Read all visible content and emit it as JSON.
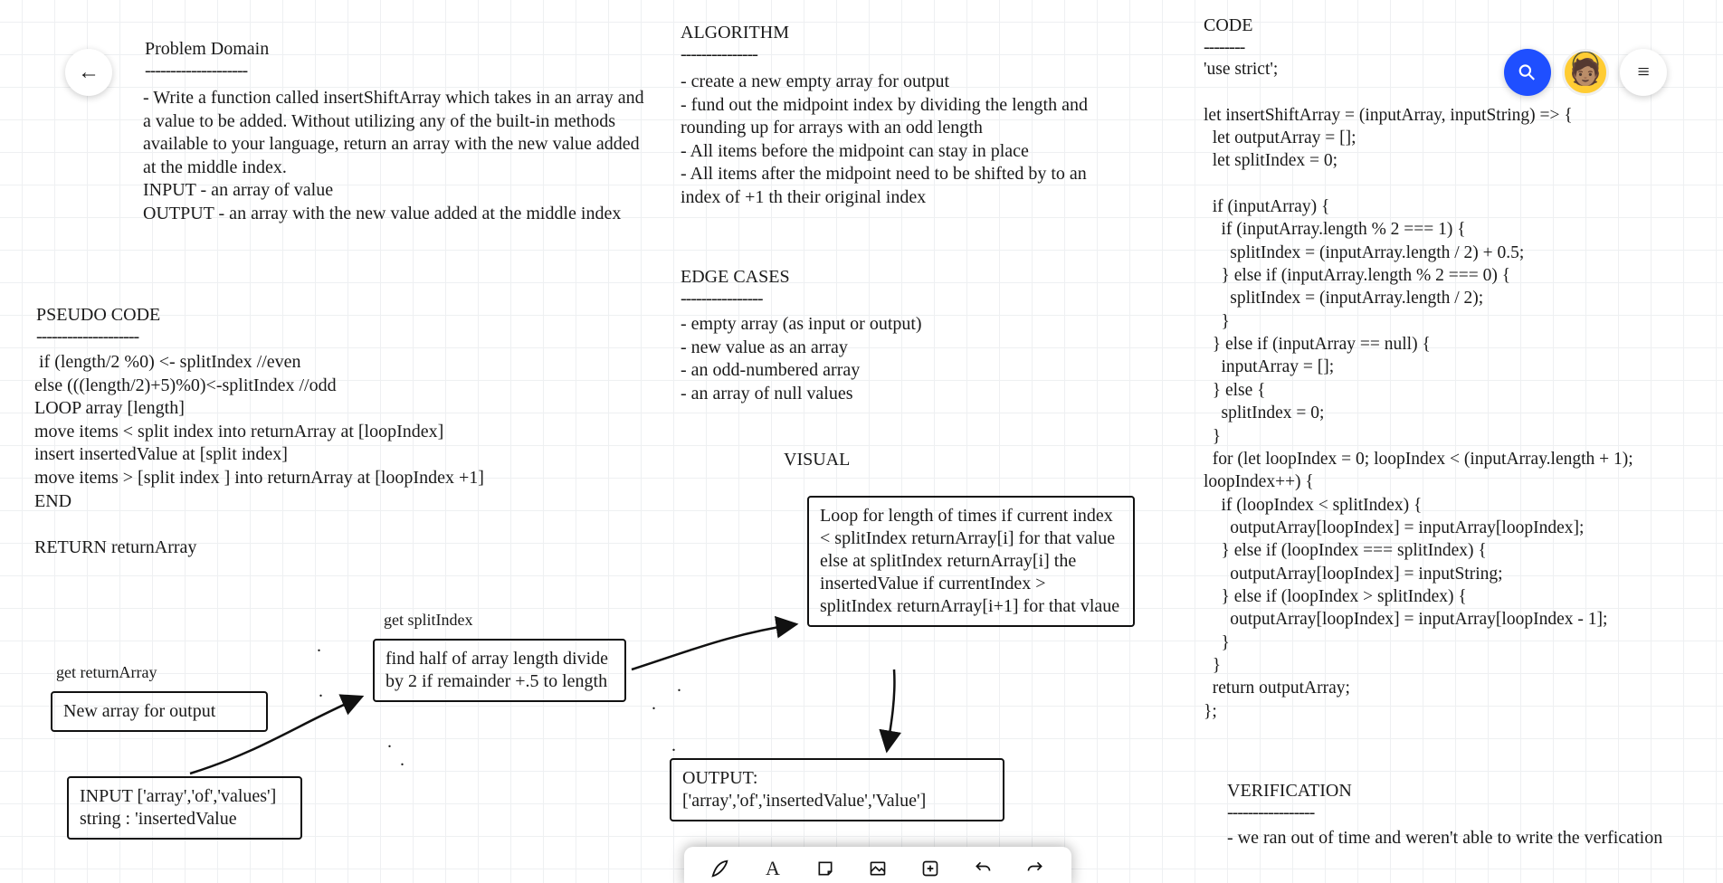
{
  "header": {
    "back_icon": "←",
    "share_icon": "⚲",
    "menu_icon": "≡"
  },
  "problem": {
    "title": "Problem Domain",
    "rule": "--------------------",
    "body": "- Write a function called insertShiftArray which takes in an array and a value to be added. Without utilizing any of the built-in methods available to your language, return an array with the new value added at the middle index.\nINPUT - an array of value\nOUTPUT - an array with the new value added at the middle index"
  },
  "pseudo": {
    "title": "PSEUDO CODE",
    "rule": "--------------------",
    "body": " if (length/2 %0) <- splitIndex //even\nelse (((length/2)+5)%0)<-splitIndex //odd\nLOOP array [length]\nmove items < split index into returnArray at [loopIndex]\ninsert insertedValue at [split index]\nmove items > [split index ] into returnArray at [loopIndex +1]\nEND\n\nRETURN returnArray"
  },
  "algorithm": {
    "title": "ALGORITHM",
    "rule": "---------------",
    "body": "- create a new empty array for output\n- fund out the midpoint index by dividing the length and rounding up for arrays with an odd length\n- All items before the midpoint can stay in place\n- All items after the midpoint need to be shifted by to an index of +1 th their original index"
  },
  "edge": {
    "title": "EDGE CASES",
    "rule": "----------------",
    "body": "- empty array (as input or output)\n- new value as an array\n- an odd-numbered array\n- an array of null values"
  },
  "visual": {
    "title": "VISUAL",
    "labels": {
      "get_return": "get returnArray",
      "get_split": "get splitIndex"
    },
    "boxes": {
      "new_array": "New array for output",
      "input": "INPUT\n['array','of','values']\nstring : 'insertedValue",
      "split": "find half of array length\ndivide by 2\nif remainder +.5 to length",
      "loop": "Loop for length of times\nif current index < splitIndex\nreturnArray[i] for that value\nelse at splitIndex\nreturnArray[i] the insertedValue\nif currentIndex > splitIndex\nreturnArray[i+1] for that vlaue",
      "output": "OUTPUT:\n['array','of','insertedValue','Value']"
    }
  },
  "code": {
    "title": "CODE",
    "rule": "--------",
    "body": "'use strict';\n\nlet insertShiftArray = (inputArray, inputString) => {\n  let outputArray = [];\n  let splitIndex = 0;\n\n  if (inputArray) {\n    if (inputArray.length % 2 === 1) {\n      splitIndex = (inputArray.length / 2) + 0.5;\n    } else if (inputArray.length % 2 === 0) {\n      splitIndex = (inputArray.length / 2);\n    }\n  } else if (inputArray == null) {\n    inputArray = [];\n  } else {\n    splitIndex = 0;\n  }\n  for (let loopIndex = 0; loopIndex < (inputArray.length + 1); loopIndex++) {\n    if (loopIndex < splitIndex) {\n      outputArray[loopIndex] = inputArray[loopIndex];\n    } else if (loopIndex === splitIndex) {\n      outputArray[loopIndex] = inputString;\n    } else if (loopIndex > splitIndex) {\n      outputArray[loopIndex] = inputArray[loopIndex - 1];\n    }\n  }\n  return outputArray;\n};"
  },
  "verification": {
    "title": "VERIFICATION",
    "rule": "-----------------",
    "body": "- we ran out of time and weren't able to write the verfication"
  },
  "toolbar": {
    "pen": "pen",
    "text": "text",
    "sticky": "sticky",
    "image": "image",
    "add": "add",
    "undo": "undo",
    "redo": "redo"
  }
}
